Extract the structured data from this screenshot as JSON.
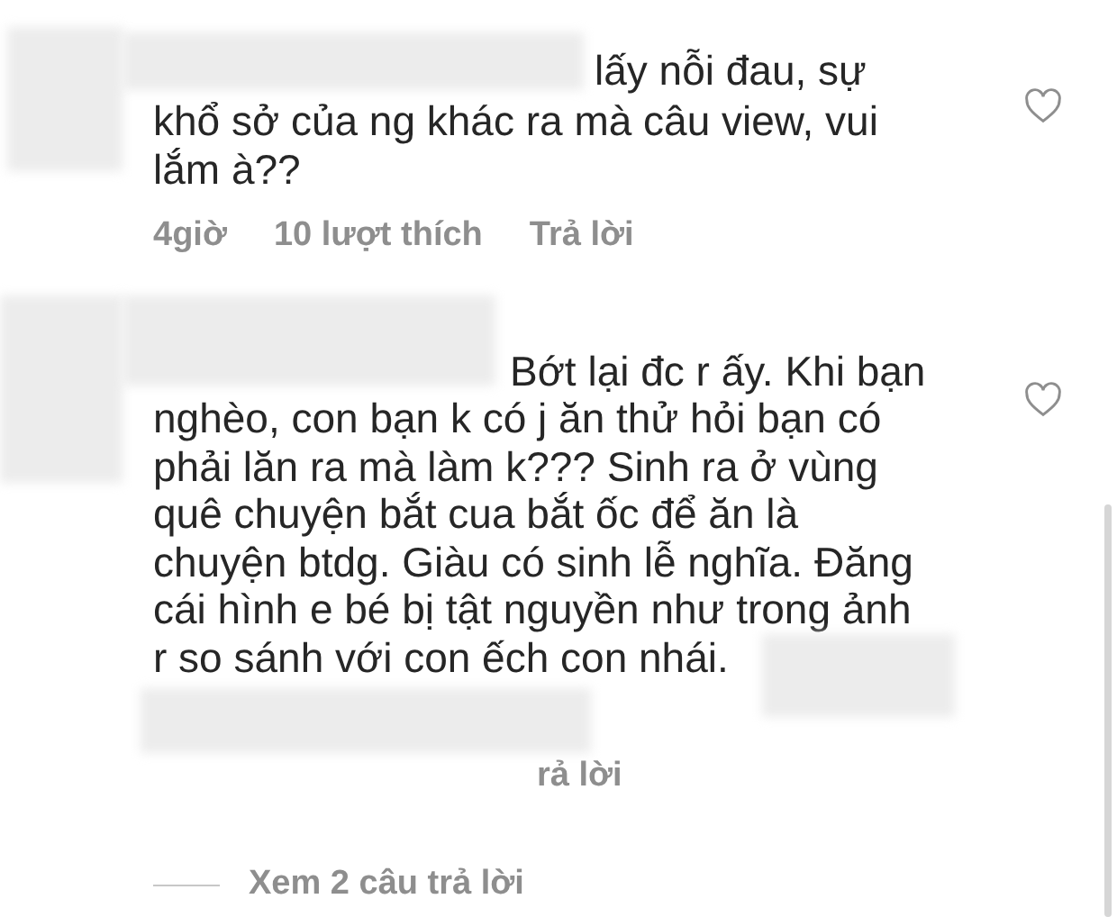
{
  "comments": [
    {
      "lines": [
        "lấy nỗi đau, sự",
        "khổ sở của ng khác ra mà câu view, vui",
        "lắm à??"
      ],
      "meta": {
        "time": "4giờ",
        "likes": "10 lượt thích",
        "reply": "Trả lời"
      },
      "liked": false
    },
    {
      "lines": [
        "Bớt lại đc r ấy. Khi bạn",
        "nghèo, con bạn k có j ăn thử hỏi bạn có",
        "phải lăn ra mà làm k??? Sinh ra ở vùng",
        "quê chuyện bắt cua bắt ốc để ăn là",
        "chuyện btdg. Giàu có sinh lễ nghĩa. Đăng",
        "cái hình e bé bị tật nguyền như trong ảnh",
        "r so sánh với con ếch con nhái."
      ],
      "meta": {
        "reply": "rả lời"
      },
      "liked": false
    }
  ],
  "view_replies": "Xem 2 câu trả lời"
}
